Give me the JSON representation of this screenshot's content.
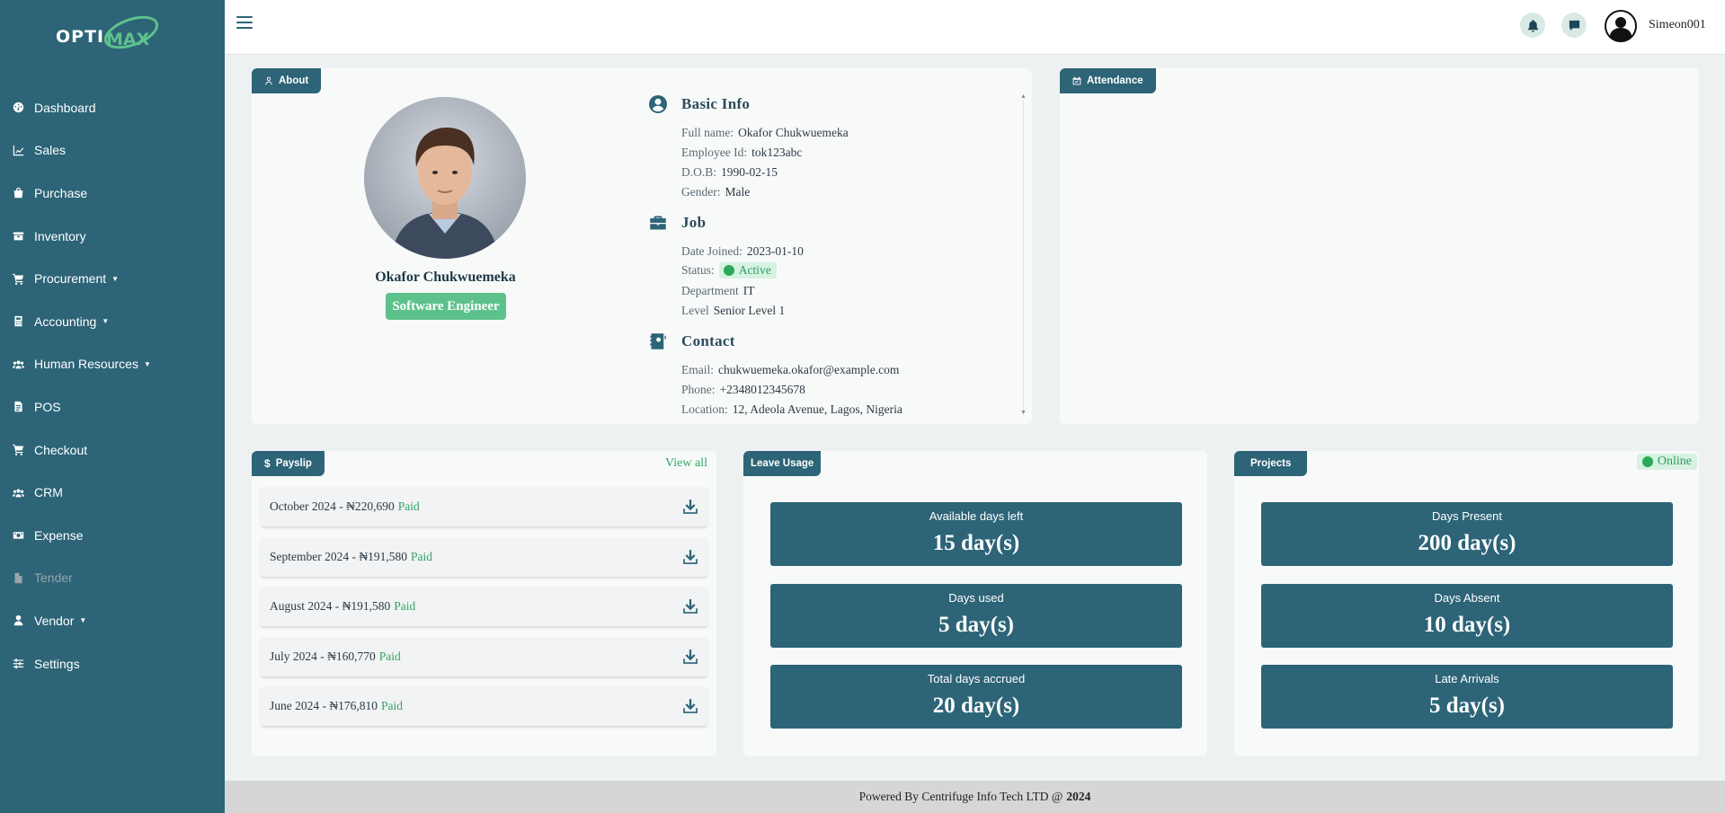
{
  "app": {
    "logo_text": "OPTI",
    "brand_color": "#2d6477",
    "accent_color": "#5dc18c"
  },
  "sidebar": {
    "items": [
      {
        "label": "Dashboard",
        "icon": "gauge-icon",
        "caret": false
      },
      {
        "label": "Sales",
        "icon": "chart-line-icon",
        "caret": false
      },
      {
        "label": "Purchase",
        "icon": "shopping-bag-icon",
        "caret": false
      },
      {
        "label": "Inventory",
        "icon": "box-icon",
        "caret": false
      },
      {
        "label": "Procurement",
        "icon": "cart-icon",
        "caret": true
      },
      {
        "label": "Accounting",
        "icon": "calculator-icon",
        "caret": true
      },
      {
        "label": "Human Resources",
        "icon": "users-icon",
        "caret": true
      },
      {
        "label": "POS",
        "icon": "receipt-icon",
        "caret": false
      },
      {
        "label": "Checkout",
        "icon": "cart-icon",
        "caret": false
      },
      {
        "label": "CRM",
        "icon": "users-icon",
        "caret": false
      },
      {
        "label": "Expense",
        "icon": "money-icon",
        "caret": false
      },
      {
        "label": "Tender",
        "icon": "file-icon",
        "caret": false,
        "dim": true
      },
      {
        "label": "Vendor",
        "icon": "user-icon",
        "caret": true
      },
      {
        "label": "Settings",
        "icon": "sliders-icon",
        "caret": false
      }
    ]
  },
  "header": {
    "username": "Simeon001"
  },
  "about": {
    "tag": "About",
    "name": "Okafor Chukwuemeka",
    "role": "Software Engineer",
    "basic_info": {
      "title": "Basic Info",
      "full_name_label": "Full name:",
      "full_name": "Okafor Chukwuemeka",
      "employee_id_label": "Employee Id:",
      "employee_id": "tok123abc",
      "dob_label": "D.O.B:",
      "dob": "1990-02-15",
      "gender_label": "Gender:",
      "gender": "Male"
    },
    "job": {
      "title": "Job",
      "date_joined_label": "Date Joined:",
      "date_joined": "2023-01-10",
      "status_label": "Status:",
      "status": "Active",
      "department_label": "Department",
      "department": "IT",
      "level_label": "Level",
      "level": "Senior Level 1"
    },
    "contact": {
      "title": "Contact",
      "email_label": "Email:",
      "email": "chukwuemeka.okafor@example.com",
      "phone_label": "Phone:",
      "phone": "+2348012345678",
      "location_label": "Location:",
      "location": "12, Adeola Avenue, Lagos, Nigeria"
    }
  },
  "attendance": {
    "tag": "Attendance"
  },
  "payslip": {
    "tag": "Payslip",
    "view_all": "View all",
    "items": [
      {
        "text": "October 2024 - ₦220,690",
        "status": "Paid"
      },
      {
        "text": "September 2024 - ₦191,580",
        "status": "Paid"
      },
      {
        "text": "August 2024 - ₦191,580",
        "status": "Paid"
      },
      {
        "text": "July 2024 - ₦160,770",
        "status": "Paid"
      },
      {
        "text": "June 2024 - ₦176,810",
        "status": "Paid"
      }
    ]
  },
  "leave": {
    "tag": "Leave Usage",
    "stats": [
      {
        "label": "Available days left",
        "value": "15 day(s)"
      },
      {
        "label": "Days used",
        "value": "5 day(s)"
      },
      {
        "label": "Total days accrued",
        "value": "20 day(s)"
      }
    ]
  },
  "projects": {
    "tag": "Projects",
    "online": "Online",
    "stats": [
      {
        "label": "Days Present",
        "value": "200 day(s)"
      },
      {
        "label": "Days Absent",
        "value": "10 day(s)"
      },
      {
        "label": "Late Arrivals",
        "value": "5 day(s)"
      }
    ]
  },
  "footer": {
    "text": "Powered By Centrifuge Info Tech LTD @",
    "year": "2024"
  }
}
